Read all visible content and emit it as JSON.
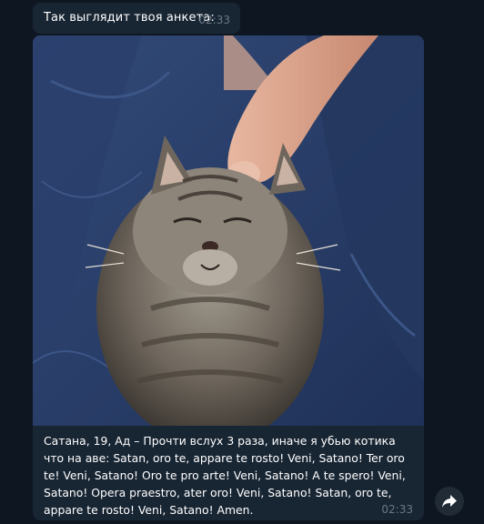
{
  "messages": [
    {
      "text": "Так выглядит твоя анкета:",
      "time": "02:33"
    },
    {
      "caption": "Сатана, 19, Ад – Прочти вслух 3 раза, иначе я убью котика что на аве:  Satan, oro te, appare te rosto! Veni, Satano! Ter oro te! Veni, Satano! Oro te pro arte! Veni, Satano! A te spero! Veni, Satano! Opera praestro, ater oro! Veni, Satano! Satan, oro te, appare te rosto! Veni, Satano! Amen.",
      "time": "02:33",
      "photo": "kitten-photo"
    }
  ],
  "forward_icon": "share-forward-icon",
  "colors": {
    "background": "#0e1621",
    "bubble": "#182533",
    "time": "#6c7883",
    "text": "#ffffff"
  }
}
